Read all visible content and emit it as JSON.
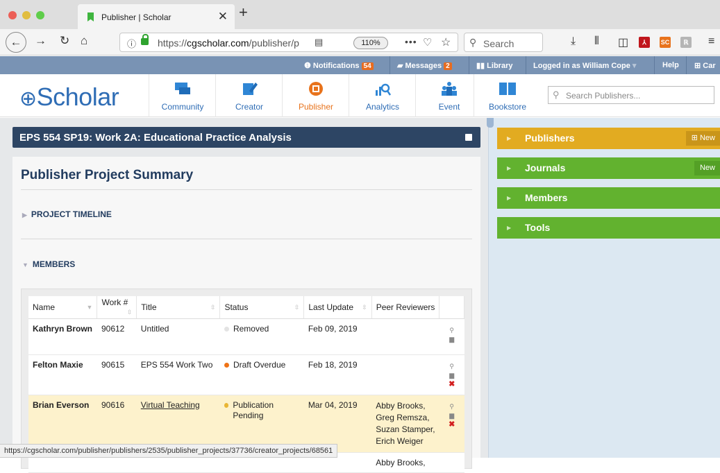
{
  "browser": {
    "tab_title": "Publisher | Scholar",
    "url_prefix": "https://",
    "url_domain": "cgscholar.com",
    "url_path": "/publisher/p",
    "zoom": "110%",
    "search_placeholder": "Search"
  },
  "topbar": {
    "notifications_label": "Notifications",
    "notifications_count": "54",
    "messages_label": "Messages",
    "messages_count": "2",
    "library_label": "Library",
    "user_label": "Logged in as William Cope",
    "help_label": "Help",
    "cart_label": "Car"
  },
  "app": {
    "logo": "Scholar",
    "nav": [
      {
        "label": "Community"
      },
      {
        "label": "Creator"
      },
      {
        "label": "Publisher"
      },
      {
        "label": "Analytics"
      },
      {
        "label": "Event"
      },
      {
        "label": "Bookstore"
      }
    ],
    "search_placeholder": "Search Publishers..."
  },
  "project": {
    "title": "EPS 554 SP19: Work 2A: Educational Practice Analysis",
    "summary_title": "Publisher Project Summary",
    "section_timeline": "PROJECT TIMELINE",
    "section_members": "MEMBERS"
  },
  "members_table": {
    "columns": [
      "Name",
      "Work #",
      "Title",
      "Status",
      "Last Update",
      "Peer Reviewers"
    ],
    "rows": [
      {
        "name": "Kathryn Brown",
        "work": "90612",
        "title": "Untitled",
        "status": "Removed",
        "status_color": "#e3e3e3",
        "updated": "Feb 09, 2019",
        "reviewers": []
      },
      {
        "name": "Felton Maxie",
        "work": "90615",
        "title": "EPS 554 Work Two",
        "status": "Draft Overdue",
        "status_color": "#ef7316",
        "updated": "Feb 18, 2019",
        "reviewers": []
      },
      {
        "name": "Brian Everson",
        "work": "90616",
        "title": "Virtual Teaching",
        "status": "Publication Pending",
        "status_color": "#e9b634",
        "updated": "Mar 04, 2019",
        "reviewers": [
          "Abby Brooks,",
          "Greg Remsza,",
          "Suzan Stamper,",
          "Erich Weiger"
        ]
      }
    ],
    "partial_row_reviewer": "Abby Brooks,"
  },
  "sidebar": {
    "items": [
      {
        "label": "Publishers",
        "new_label": "New",
        "color": "#e2ab21",
        "new_bg": "#c9951a"
      },
      {
        "label": "Journals",
        "new_label": "New",
        "color": "#62b22f",
        "new_bg": "#54a026"
      },
      {
        "label": "Members",
        "color": "#62b22f"
      },
      {
        "label": "Tools",
        "color": "#62b22f"
      }
    ]
  },
  "status_bar": "https://cgscholar.com/publisher/publishers/2535/publisher_projects/37736/creator_projects/68561",
  "colors": {
    "brand_blue": "#2f6db5",
    "publisher_orange": "#e8731c",
    "title_bar": "#2d4564",
    "highlight_row": "#fdf2cc"
  }
}
